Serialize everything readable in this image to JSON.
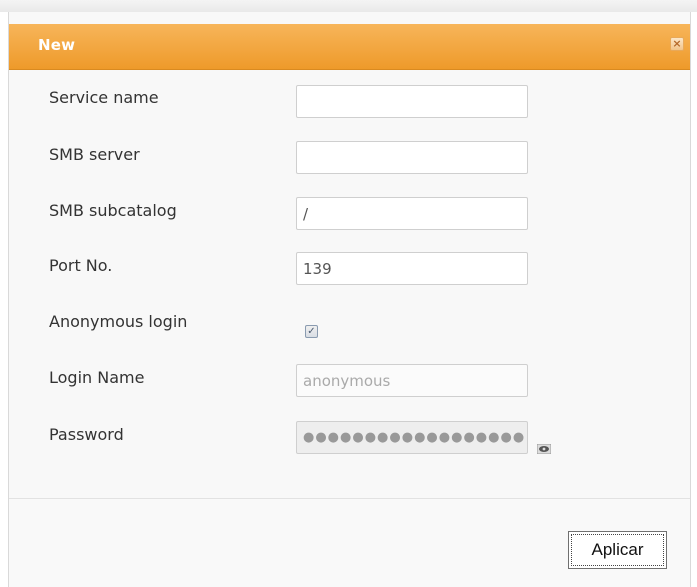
{
  "dialog": {
    "title": "New",
    "close_glyph": "×"
  },
  "form": {
    "service_name": {
      "label": "Service name",
      "value": ""
    },
    "smb_server": {
      "label": "SMB server",
      "value": ""
    },
    "smb_subcatalog": {
      "label": "SMB subcatalog",
      "value": "/"
    },
    "port": {
      "label": "Port No.",
      "value": "139"
    },
    "anonymous_login": {
      "label": "Anonymous login",
      "checked": true,
      "check_glyph": "✓"
    },
    "login_name": {
      "label": "Login Name",
      "value": "anonymous"
    },
    "password": {
      "label": "Password",
      "masked_value": "●●●●●●●●●●●●●●●●●●"
    }
  },
  "footer": {
    "apply_label": "Aplicar"
  },
  "icons": {
    "close": "close-icon",
    "password_toggle": "eye-icon"
  },
  "colors": {
    "titlebar": "#f0a33a",
    "title_text": "#ffffff",
    "label_text": "#333333"
  }
}
